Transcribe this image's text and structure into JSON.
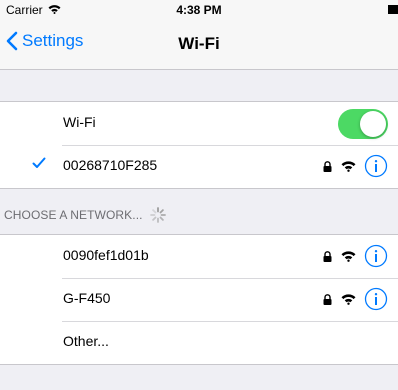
{
  "status_bar": {
    "carrier": "Carrier",
    "time": "4:38 PM"
  },
  "nav": {
    "back_label": "Settings",
    "title": "Wi-Fi"
  },
  "wifi_toggle": {
    "label": "Wi-Fi",
    "on": true,
    "color": "#4cd964"
  },
  "connected_network": {
    "name": "00268710F285",
    "secured": true,
    "selected": true
  },
  "section": {
    "header": "CHOOSE A NETWORK..."
  },
  "networks": [
    {
      "name": "0090fef1d01b",
      "secured": true
    },
    {
      "name": "G-F450",
      "secured": true
    },
    {
      "name": "Other..."
    }
  ],
  "colors": {
    "accent": "#007aff",
    "background": "#efeff4"
  }
}
